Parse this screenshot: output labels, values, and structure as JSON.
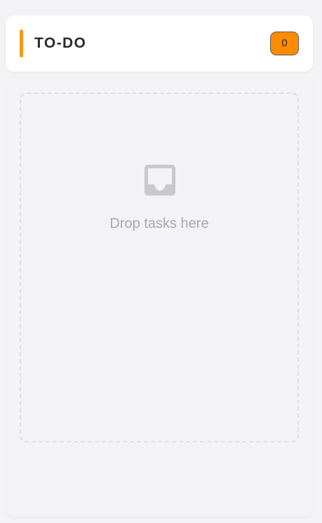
{
  "column": {
    "title": "TO-DO",
    "count": "0",
    "accent_color": "#f59a12",
    "badge_color": "#ff8c00"
  },
  "drop_zone": {
    "icon": "inbox-icon",
    "text": "Drop tasks here"
  }
}
